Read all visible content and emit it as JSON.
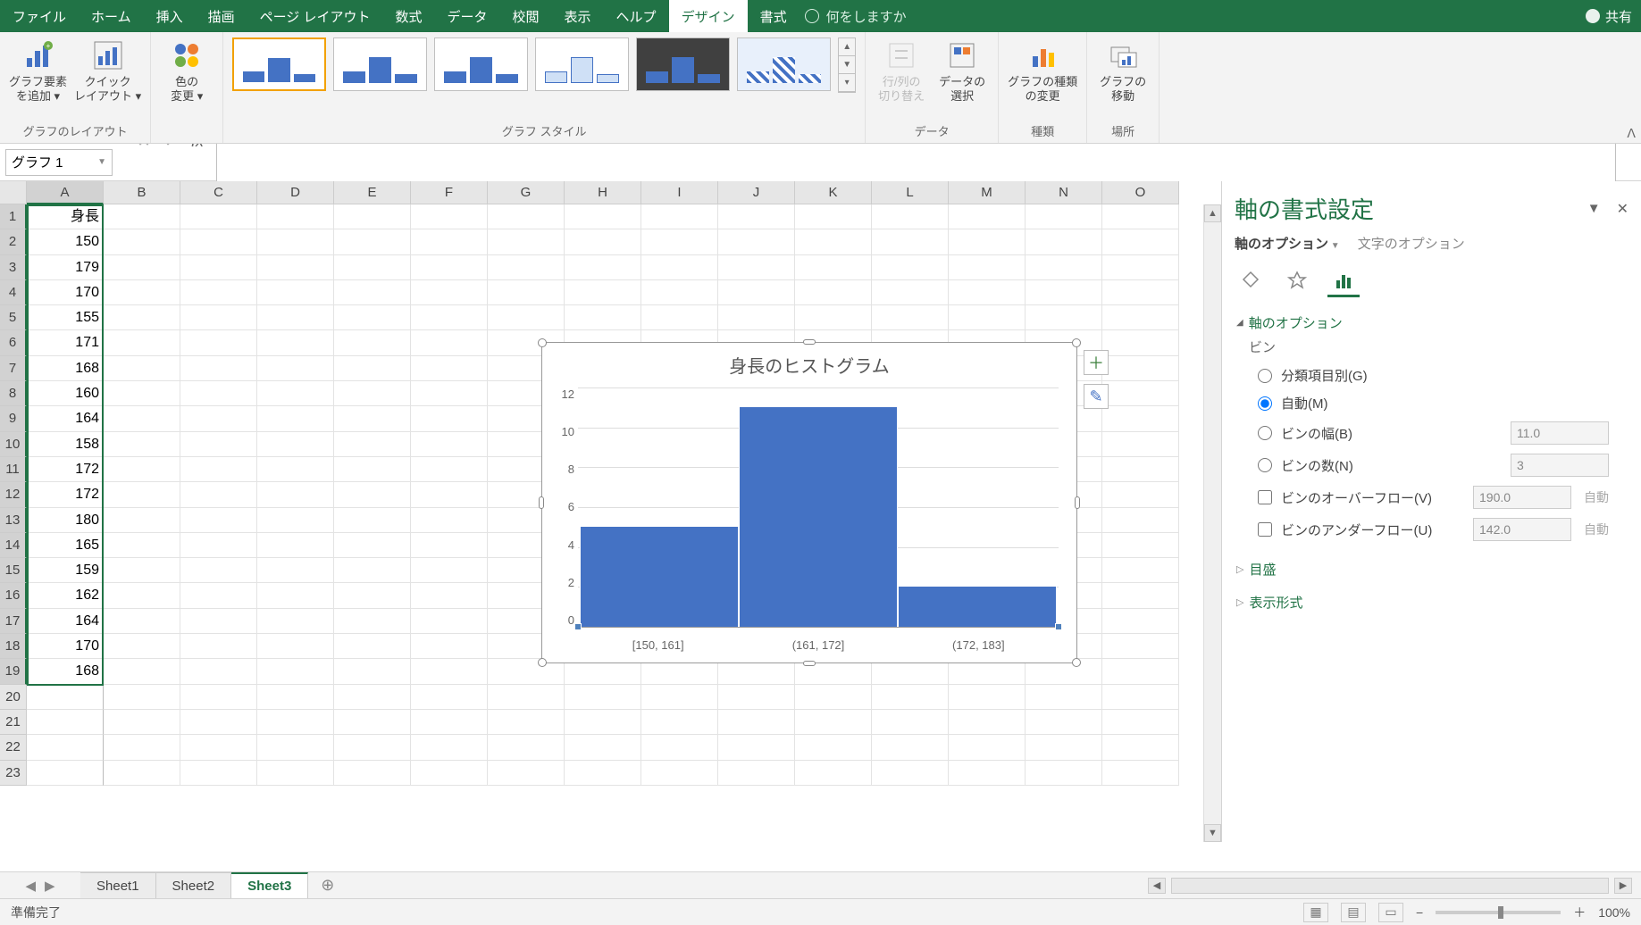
{
  "menu": {
    "tabs": [
      "ファイル",
      "ホーム",
      "挿入",
      "描画",
      "ページ レイアウト",
      "数式",
      "データ",
      "校閲",
      "表示",
      "ヘルプ",
      "デザイン",
      "書式"
    ],
    "active_index": 10,
    "tellme": "何をしますか",
    "share": "共有"
  },
  "ribbon": {
    "layout": {
      "add_element": "グラフ要素\nを追加 ▾",
      "quick_layout": "クイック\nレイアウト ▾",
      "group": "グラフのレイアウト"
    },
    "colors": {
      "change_colors": "色の\n変更 ▾"
    },
    "styles_group": "グラフ スタイル",
    "data": {
      "switch": "行/列の\n切り替え",
      "select": "データの\n選択",
      "group": "データ"
    },
    "type": {
      "change_type": "グラフの種類\nの変更",
      "group": "種類"
    },
    "loc": {
      "move": "グラフの\n移動",
      "group": "場所"
    }
  },
  "namebox": "グラフ 1",
  "sheet": {
    "header": "身長",
    "values": [
      150,
      179,
      170,
      155,
      171,
      168,
      160,
      164,
      158,
      172,
      172,
      180,
      165,
      159,
      162,
      164,
      170,
      168
    ],
    "cols": [
      "A",
      "B",
      "C",
      "D",
      "E",
      "F",
      "G",
      "H",
      "I",
      "J",
      "K",
      "L",
      "M",
      "N",
      "O"
    ]
  },
  "chart_data": {
    "type": "bar",
    "title": "身長のヒストグラム",
    "categories": [
      "[150, 161]",
      "(161, 172]",
      "(172, 183]"
    ],
    "values": [
      5,
      11,
      2
    ],
    "ylabel": "",
    "xlabel": "",
    "yticks": [
      0,
      2,
      4,
      6,
      8,
      10,
      12
    ],
    "ylim": [
      0,
      12
    ]
  },
  "taskpane": {
    "title": "軸の書式設定",
    "tab_on": "軸のオプション",
    "tab_off": "文字のオプション",
    "section": "軸のオプション",
    "bin": "ビン",
    "opt_category": "分類項目別(G)",
    "opt_auto": "自動(M)",
    "opt_binwidth": "ビンの幅(B)",
    "opt_bincount": "ビンの数(N)",
    "opt_overflow": "ビンのオーバーフロー(V)",
    "opt_underflow": "ビンのアンダーフロー(U)",
    "val_binwidth": "11.0",
    "val_bincount": "3",
    "val_overflow": "190.0",
    "val_underflow": "142.0",
    "auto": "自動",
    "sec_tick": "目盛",
    "sec_numfmt": "表示形式"
  },
  "sheets": {
    "tabs": [
      "Sheet1",
      "Sheet2",
      "Sheet3"
    ],
    "active": 2
  },
  "status": {
    "ready": "準備完了",
    "zoom": "100%"
  }
}
